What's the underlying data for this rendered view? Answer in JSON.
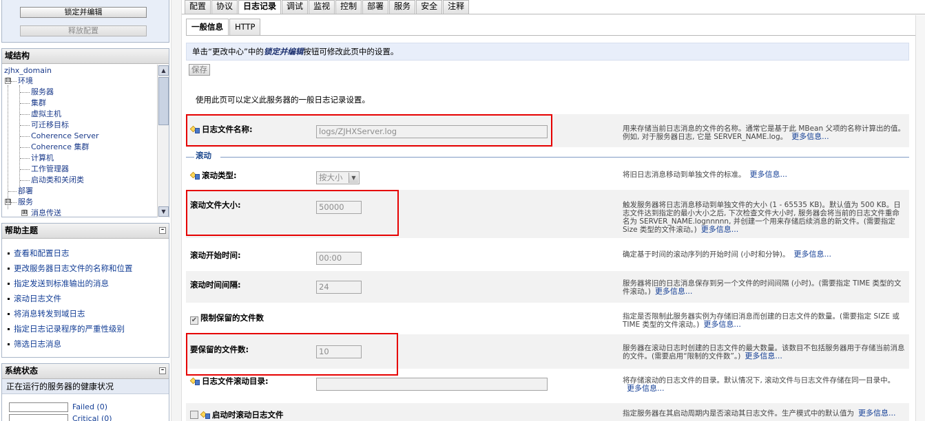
{
  "lock_panel": {
    "lock_edit_label": "锁定并编辑",
    "release_config_label": "释放配置"
  },
  "domain_structure": {
    "title": "域结构",
    "collapse_icon": "minus-box-icon",
    "tree": [
      {
        "label": "zjhx_domain"
      },
      {
        "label": "环境",
        "expander": "⊟"
      },
      {
        "label": "服务器"
      },
      {
        "label": "集群"
      },
      {
        "label": "虚拟主机"
      },
      {
        "label": "可迁移目标"
      },
      {
        "label": "Coherence Server"
      },
      {
        "label": "Coherence 集群"
      },
      {
        "label": "计算机"
      },
      {
        "label": "工作管理器"
      },
      {
        "label": "启动类和关闭类"
      },
      {
        "label": "部署"
      },
      {
        "label": "服务",
        "expander": "⊟"
      },
      {
        "label": "消息传送",
        "expander": "⊞"
      }
    ]
  },
  "help": {
    "title": "帮助主题",
    "items": [
      "查看和配置日志",
      "更改服务器日志文件的名称和位置",
      "指定发送到标准输出的消息",
      "滚动日志文件",
      "将消息转发到域日志",
      "指定日志记录程序的严重性级别",
      "筛选日志消息"
    ]
  },
  "system_status": {
    "title": "系统状态",
    "subtitle": "正在运行的服务器的健康状况",
    "rows": [
      {
        "label": "Failed (0)"
      },
      {
        "label": "Critical (0)"
      }
    ]
  },
  "tabs": [
    "配置",
    "协议",
    "日志记录",
    "调试",
    "监视",
    "控制",
    "部署",
    "服务",
    "安全",
    "注释"
  ],
  "active_tab": "日志记录",
  "subtabs": [
    "一般信息",
    "HTTP"
  ],
  "active_subtab": "一般信息",
  "info_bar": {
    "prefix": "单击“更改中心”中的",
    "emphasis": "锁定并编辑",
    "suffix": "按钮可修改此页中的设置。"
  },
  "save_label": "保存",
  "intro": "使用此页可以定义此服务器的一般日志记录设置。",
  "more_info": "更多信息...",
  "fields": {
    "log_file_name": {
      "label": "日志文件名称:",
      "value": "logs/ZJHXServer.log",
      "desc": "用来存储当前日志消息的文件的名称。通常它是基于此 MBean 父项的名称计算出的值。例如, 对于服务器日志, 它是 SERVER_NAME.log。"
    },
    "section_rotation": "滚动",
    "rotation_type": {
      "label": "滚动类型:",
      "value": "按大小",
      "desc": "将旧日志消息移动到单独文件的标准。"
    },
    "rotation_file_size": {
      "label": "滚动文件大小:",
      "value": "50000",
      "desc": "触发服务器将日志消息移动到单独文件的大小 (1 - 65535 KB)。默认值为 500 KB。日志文件达到指定的最小大小之后, 下次检查文件大小时, 服务器会将当前的日志文件重命名为 SERVER_NAME.lognnnnn, 并创建一个用来存储后续消息的新文件。(需要指定 Size 类型的文件滚动。)"
    },
    "rotation_start_time": {
      "label": "滚动开始时间:",
      "value": "00:00",
      "desc": "确定基于时间的滚动序列的开始时间 (小时和分钟)。"
    },
    "rotation_interval": {
      "label": "滚动时间间隔:",
      "value": "24",
      "desc": "服务器将旧的日志消息保存到另一个文件的时间间隔 (小时)。(需要指定 TIME 类型的文件滚动。)"
    },
    "limit_retained": {
      "label": "限制保留的文件数",
      "checked": true,
      "desc": "指定是否限制此服务器实例为存储旧消息而创建的日志文件的数量。(需要指定 SIZE 或 TIME 类型的文件滚动。)"
    },
    "files_to_retain": {
      "label": "要保留的文件数:",
      "value": "10",
      "desc": "服务器在滚动日志时创建的日志文件的最大数量。该数目不包括服务器用于存储当前消息的文件。(需要启用“限制的文件数”。)"
    },
    "rotate_dir": {
      "label": "日志文件滚动目录:",
      "value": "",
      "desc": "将存储滚动的日志文件的目录。默认情况下, 滚动文件与日志文件存储在同一目录中。"
    },
    "rotate_on_startup": {
      "label": "启动时滚动日志文件",
      "checked": false,
      "desc": "指定服务器在其启动周期内是否滚动其日志文件。生产模式中的默认值为"
    }
  },
  "colors": {
    "highlight_red": "#e60000",
    "link_blue": "#123d95",
    "info_bg": "#e8eefa"
  }
}
